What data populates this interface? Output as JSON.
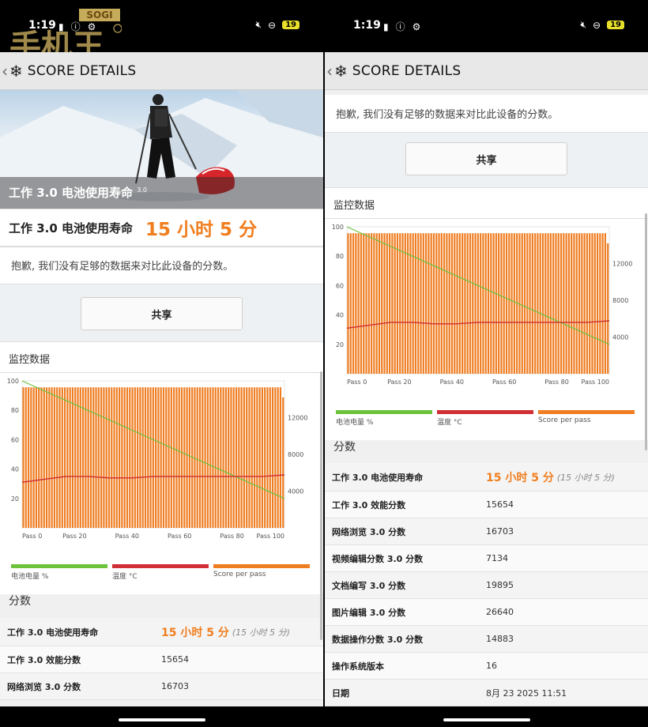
{
  "status": {
    "time": "1:19",
    "battery": "19"
  },
  "watermark": {
    "brand": "SOGI",
    "logo_text": "手机王"
  },
  "header": {
    "title": "SCORE DETAILS"
  },
  "test": {
    "hero_caption": "工作 3.0 电池使用寿命",
    "hero_version": "3.0",
    "result_label": "工作 3.0 电池使用寿命",
    "result_value": "15 小时 5 分",
    "note": "抱歉, 我们没有足够的数据来对比此设备的分数。",
    "share_label": "共享"
  },
  "monitoring": {
    "title": "监控数据",
    "legend": [
      {
        "label": "电池电量 %",
        "color": "#6cc33b"
      },
      {
        "label": "温度 °C",
        "color": "#cf2f35"
      },
      {
        "label": "Score per pass",
        "color": "#ef7d22"
      }
    ]
  },
  "chart_data": {
    "type": "bar",
    "x_tick_labels": [
      "Pass 0",
      "Pass 20",
      "Pass 40",
      "Pass 60",
      "Pass 80",
      "Pass 100"
    ],
    "left_axis_ticks": [
      "100",
      "80",
      "60",
      "40",
      "20"
    ],
    "right_axis_ticks": [
      "12000",
      "8000",
      "4000"
    ],
    "ylim_left": [
      0,
      100
    ],
    "ylim_right": [
      0,
      16000
    ],
    "series": [
      {
        "name": "Score per pass",
        "color": "#ef7d22",
        "approx_value": 15300,
        "count": 101,
        "last_value": 14200
      },
      {
        "name": "电池电量 %",
        "color": "#6cc33b",
        "start": 100,
        "end": 20
      },
      {
        "name": "温度 °C",
        "color": "#cf2f35",
        "values": [
          31,
          33,
          35,
          35,
          34,
          34,
          35,
          35,
          35,
          35,
          35,
          35,
          36
        ]
      }
    ]
  },
  "scores": {
    "title": "分数",
    "rows": [
      {
        "label": "工作 3.0 电池使用寿命",
        "value": "15 小时 5 分",
        "sub": "(15 小时 5 分)"
      },
      {
        "label": "工作 3.0 效能分数",
        "value": "15654"
      },
      {
        "label": "网络浏览 3.0 分数",
        "value": "16703"
      },
      {
        "label": "视频编辑分数 3.0 分数",
        "value": "7134"
      },
      {
        "label": "文档编写 3.0 分数",
        "value": "19895"
      },
      {
        "label": "图片编辑 3.0 分数",
        "value": "26640"
      },
      {
        "label": "数据操作分数 3.0 分数",
        "value": "14883"
      },
      {
        "label": "操作系统版本",
        "value": "16"
      },
      {
        "label": "日期",
        "value": "8月 23 2025 11:51"
      }
    ]
  }
}
